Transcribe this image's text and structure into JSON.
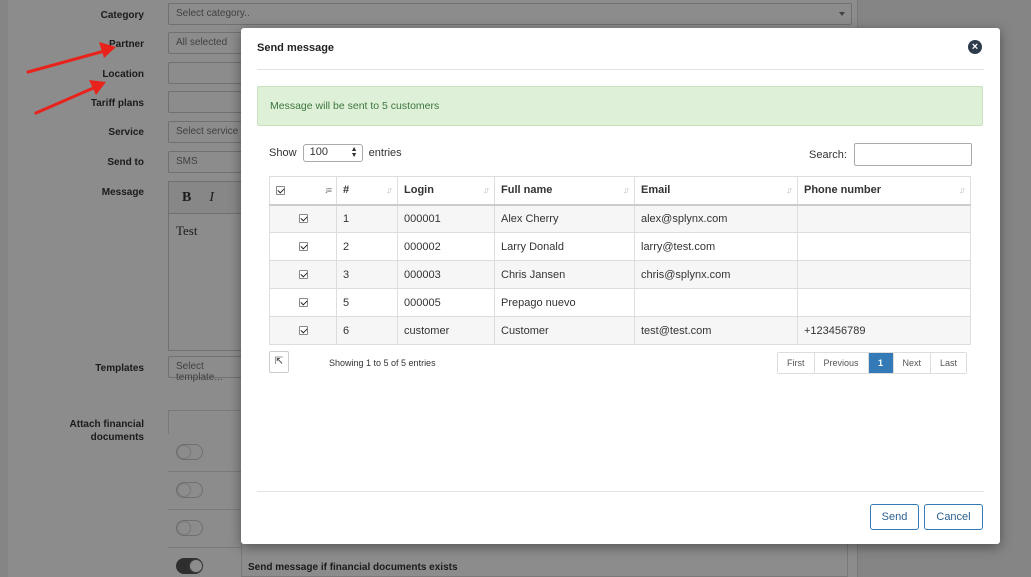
{
  "background_form": {
    "labels": {
      "category": "Category",
      "partner": "Partner",
      "location": "Location",
      "tariff_plans": "Tariff plans",
      "service": "Service",
      "send_to": "Send to",
      "message": "Message",
      "templates": "Templates",
      "attach_line1": "Attach financial",
      "attach_line2": "documents"
    },
    "values": {
      "category": "Select category..",
      "partner": "All selected",
      "service": "Select service ty",
      "send_to": "SMS",
      "templates": "Select template...",
      "message_text": "Test"
    },
    "editor_toolbar": {
      "bold": "B",
      "italic": "I"
    },
    "toggle_label": "Send message if financial documents exists"
  },
  "modal": {
    "title": "Send message",
    "close_icon": "close-circle-icon",
    "alert": "Message will be sent to 5 customers",
    "show_label": "Show",
    "entries_value": "100",
    "entries_label": "entries",
    "search_label": "Search:",
    "table": {
      "headers": [
        "#",
        "Login",
        "Full name",
        "Email",
        "Phone number"
      ],
      "rows": [
        {
          "num": "1",
          "login": "000001",
          "name": "Alex Cherry",
          "email": "alex@splynx.com",
          "phone": ""
        },
        {
          "num": "2",
          "login": "000002",
          "name": "Larry Donald",
          "email": "larry@test.com",
          "phone": ""
        },
        {
          "num": "3",
          "login": "000003",
          "name": "Chris Jansen",
          "email": "chris@splynx.com",
          "phone": ""
        },
        {
          "num": "5",
          "login": "000005",
          "name": "Prepago nuevo",
          "email": "",
          "phone": ""
        },
        {
          "num": "6",
          "login": "customer",
          "name": "Customer",
          "email": "test@test.com",
          "phone": "+123456789"
        }
      ]
    },
    "info": "Showing 1 to 5 of 5 entries",
    "pager": {
      "first": "First",
      "previous": "Previous",
      "current": "1",
      "next": "Next",
      "last": "Last"
    },
    "send_button": "Send",
    "cancel_button": "Cancel"
  },
  "colors": {
    "accent": "#337ab7",
    "alert_bg": "#dff0d8",
    "alert_text": "#3c763d",
    "annotation_arrow": "#e8231c"
  }
}
